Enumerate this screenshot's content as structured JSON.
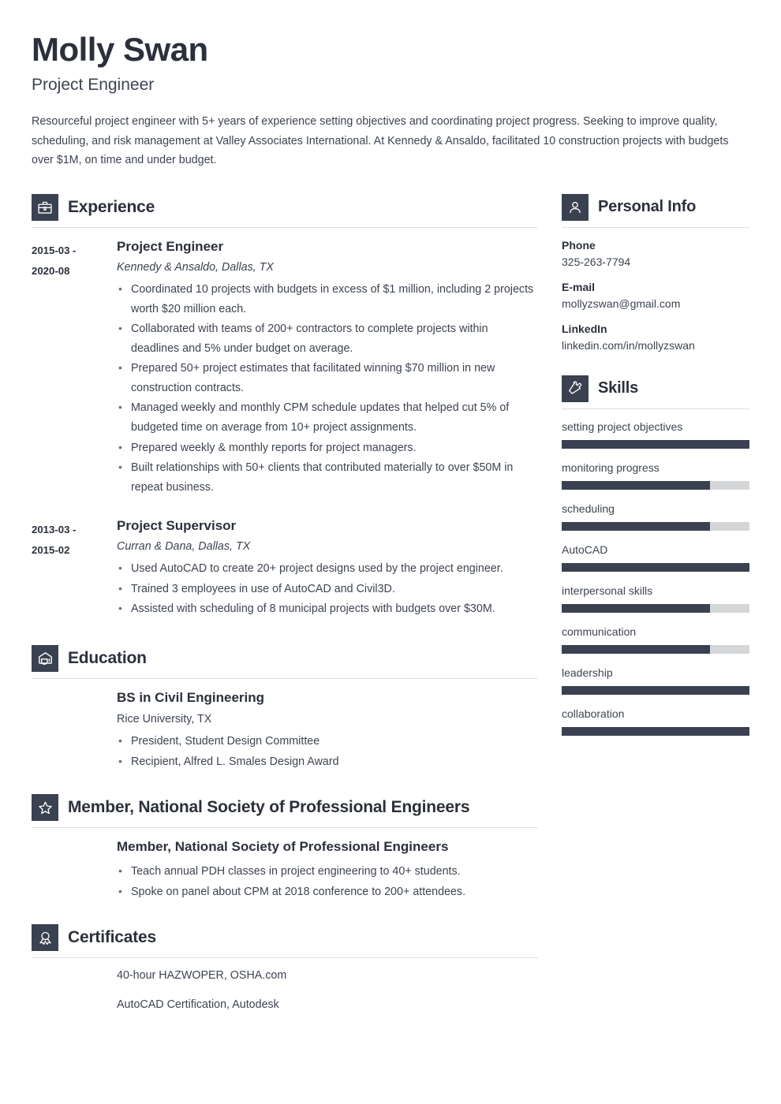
{
  "header": {
    "name": "Molly Swan",
    "job_title": "Project Engineer",
    "summary": "Resourceful project engineer with 5+ years of experience setting objectives and coordinating project progress. Seeking to improve quality, scheduling, and risk management at Valley Associates International. At Kennedy & Ansaldo, facilitated 10 construction projects with budgets over $1M, on time and under budget."
  },
  "colors": {
    "accent_dark": "#3a4150",
    "heading": "#2b303b",
    "body": "#3d4450",
    "rule": "#dcdee2",
    "track": "#d4d6d8"
  },
  "sections": {
    "experience": {
      "title": "Experience",
      "icon": "briefcase-icon",
      "entries": [
        {
          "dates": "2015-03 - 2020-08",
          "date_from": "2015-03 -",
          "date_to": "2020-08",
          "role": "Project Engineer",
          "org": "Kennedy & Ansaldo, Dallas, TX",
          "bullets": [
            "Coordinated 10 projects with budgets in excess of $1 million, including 2 projects worth $20 million each.",
            "Collaborated with teams of 200+ contractors to complete projects within deadlines and 5% under budget on average.",
            "Prepared 50+ project estimates that facilitated winning $70 million in new construction contracts.",
            "Managed weekly and monthly CPM schedule updates that helped cut 5% of budgeted time on average from 10+ project assignments.",
            "Prepared weekly & monthly reports for project managers.",
            "Built relationships with 50+ clients that contributed materially to over $50M in repeat business."
          ]
        },
        {
          "dates": "2013-03 - 2015-02",
          "date_from": "2013-03 -",
          "date_to": "2015-02",
          "role": "Project Supervisor",
          "org": "Curran & Dana, Dallas, TX",
          "bullets": [
            "Used AutoCAD to create 20+ project designs used by the project engineer.",
            "Trained 3 employees in use of AutoCAD and Civil3D.",
            "Assisted with scheduling of 8 municipal projects with budgets over $30M."
          ]
        }
      ]
    },
    "education": {
      "title": "Education",
      "icon": "graduation-cap-icon",
      "degree": "BS in Civil Engineering",
      "school": "Rice University, TX",
      "bullets": [
        "President, Student Design Committee",
        "Recipient, Alfred L. Smales Design Award"
      ]
    },
    "membership": {
      "title": "Member, National Society of Professional Engineers",
      "icon": "star-icon",
      "entry_title": "Member, National Society of Professional Engineers",
      "bullets": [
        "Teach annual PDH classes in project engineering to 40+ students.",
        "Spoke on panel about CPM at 2018 conference to 200+ attendees."
      ]
    },
    "certificates": {
      "title": "Certificates",
      "icon": "award-ribbon-icon",
      "items": [
        "40-hour HAZWOPER, OSHA.com",
        "AutoCAD Certification, Autodesk"
      ]
    },
    "personal_info": {
      "title": "Personal Info",
      "icon": "person-icon",
      "fields": [
        {
          "label": "Phone",
          "value": "325-263-7794"
        },
        {
          "label": "E-mail",
          "value": "mollyzswan@gmail.com"
        },
        {
          "label": "LinkedIn",
          "value": "linkedin.com/in/mollyzswan"
        }
      ]
    },
    "skills": {
      "title": "Skills",
      "icon": "puzzle-piece-icon",
      "items": [
        {
          "name": "setting project objectives",
          "level": 100
        },
        {
          "name": "monitoring progress",
          "level": 79
        },
        {
          "name": "scheduling",
          "level": 79
        },
        {
          "name": "AutoCAD",
          "level": 100
        },
        {
          "name": "interpersonal skills",
          "level": 79
        },
        {
          "name": "communication",
          "level": 79
        },
        {
          "name": "leadership",
          "level": 100
        },
        {
          "name": "collaboration",
          "level": 100
        }
      ]
    }
  }
}
